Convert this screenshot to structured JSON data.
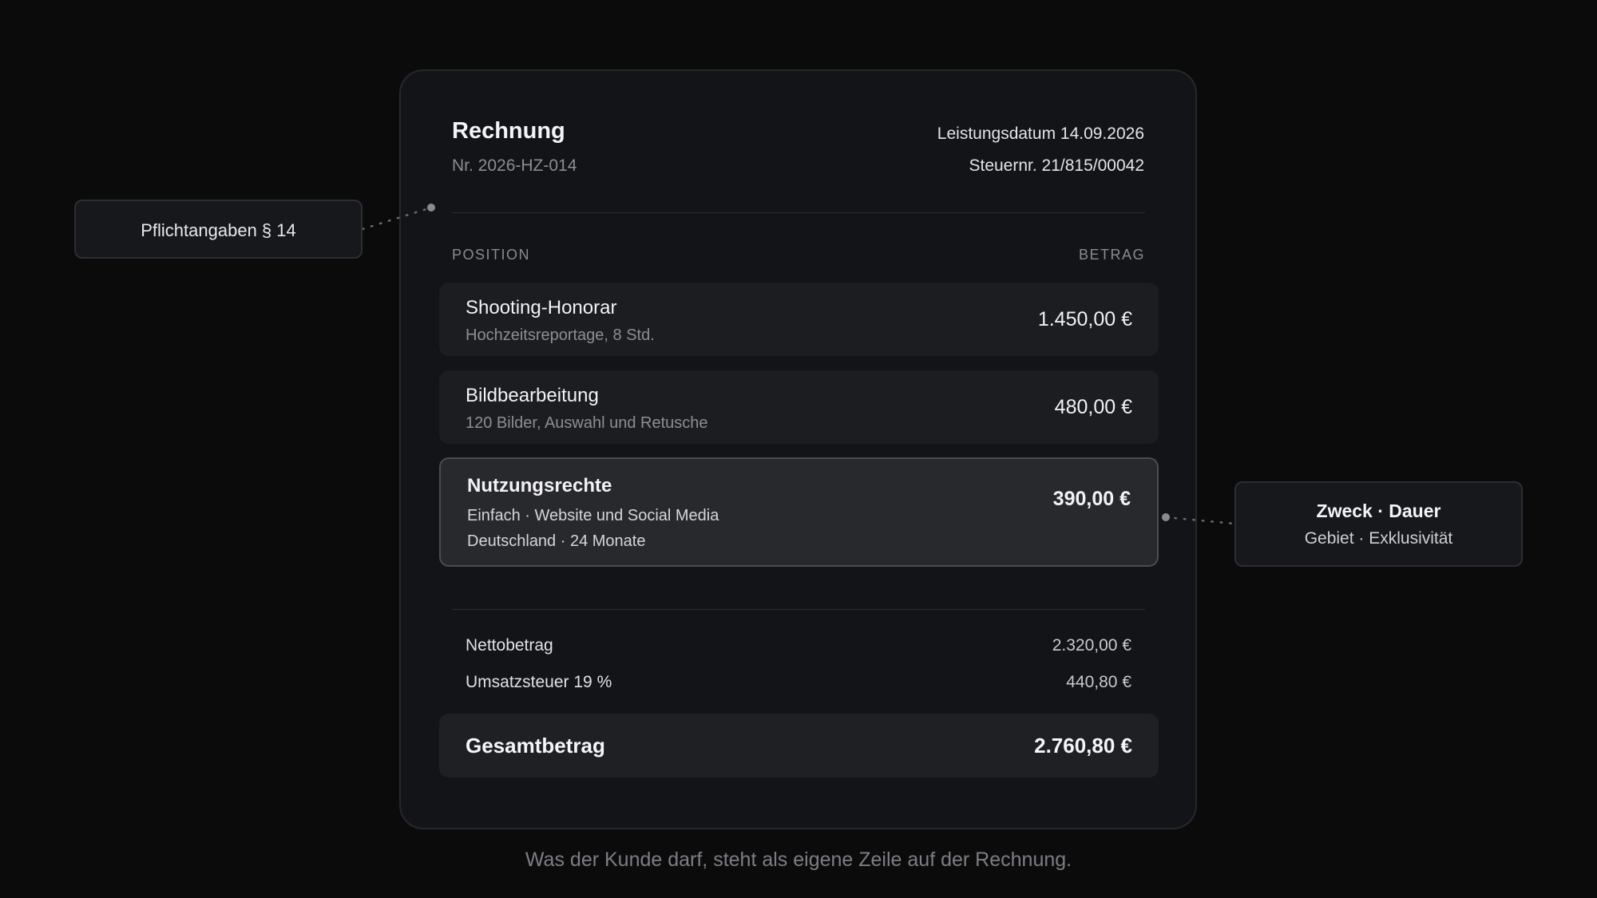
{
  "invoice": {
    "title": "Rechnung",
    "number": "Nr. 2026-HZ-014",
    "service_date": "Leistungsdatum 14.09.2026",
    "tax_number": "Steuernr. 21/815/00042"
  },
  "columns": {
    "position": "POSITION",
    "amount": "BETRAG"
  },
  "line_items": [
    {
      "title": "Shooting-Honorar",
      "details": [
        "Hochzeitsreportage, 8 Std."
      ],
      "amount": "1.450,00 €",
      "highlighted": false
    },
    {
      "title": "Bildbearbeitung",
      "details": [
        "120 Bilder, Auswahl und Retusche"
      ],
      "amount": "480,00 €",
      "highlighted": false
    },
    {
      "title": "Nutzungsrechte",
      "details": [
        "Einfach · Website und Social Media",
        "Deutschland · 24 Monate"
      ],
      "amount": "390,00 €",
      "highlighted": true
    }
  ],
  "summary": {
    "net_label": "Nettobetrag",
    "net_value": "2.320,00 €",
    "vat_label": "Umsatzsteuer 19 %",
    "vat_value": "440,80 €",
    "total_label": "Gesamtbetrag",
    "total_value": "2.760,80 €"
  },
  "callouts": {
    "left": "Pflichtangaben § 14",
    "right_title": "Zweck · Dauer",
    "right_subtitle": "Gebiet · Exklusivität"
  },
  "caption": "Was der Kunde darf, steht als eigene Zeile auf der Rechnung.",
  "colors": {
    "background": "#0b0b0c",
    "card": "#131417",
    "row": "#1c1d21",
    "row_highlight": "#28292d",
    "text": "#f2f2f4",
    "muted": "#8c8d93"
  }
}
